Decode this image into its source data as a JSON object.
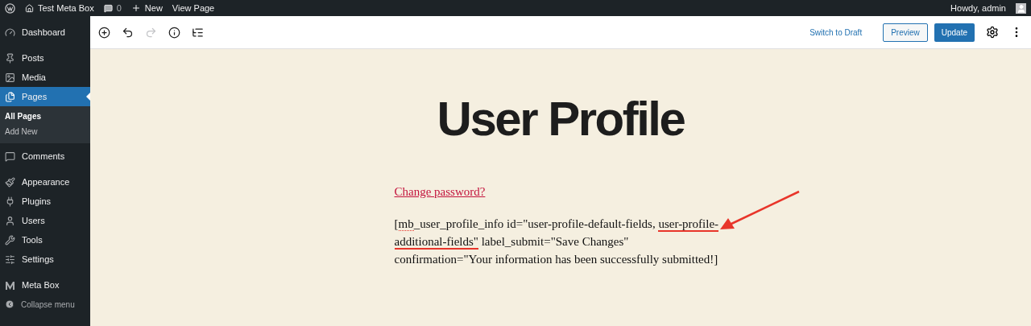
{
  "admin_bar": {
    "site": "Test Meta Box",
    "comments": "0",
    "new": "New",
    "view": "View Page",
    "howdy": "Howdy, admin"
  },
  "sidebar": {
    "items": [
      {
        "label": "Dashboard",
        "selected": false
      },
      {
        "label": "Posts",
        "selected": false
      },
      {
        "label": "Media",
        "selected": false
      },
      {
        "label": "Pages",
        "selected": true,
        "children": [
          {
            "label": "All Pages",
            "selected": true
          },
          {
            "label": "Add New",
            "selected": false
          }
        ]
      },
      {
        "label": "Comments",
        "selected": false
      },
      {
        "label": "Appearance",
        "selected": false
      },
      {
        "label": "Plugins",
        "selected": false
      },
      {
        "label": "Users",
        "selected": false
      },
      {
        "label": "Tools",
        "selected": false
      },
      {
        "label": "Settings",
        "selected": false
      },
      {
        "label": "Meta Box",
        "selected": false
      }
    ],
    "collapse": "Collapse menu"
  },
  "toolbar": {
    "tools": [
      {
        "disabled": false
      },
      {
        "disabled": false
      },
      {
        "disabled": true
      },
      {
        "disabled": false
      },
      {
        "disabled": false
      }
    ],
    "switch_to_draft": "Switch to Draft",
    "preview": "Preview",
    "update": "Update"
  },
  "content": {
    "title": "User Profile",
    "link": "Change password?",
    "lines": [
      [
        {
          "text": "[",
          "underlined": false,
          "spell_error": false
        },
        {
          "text": "mb",
          "underlined": false,
          "spell_error": true
        },
        {
          "text": "_user_profile_info id=\"user-profile-default-fields, ",
          "underlined": false,
          "spell_error": false
        },
        {
          "text": "user-profile-",
          "underlined": true,
          "spell_error": false
        }
      ],
      [
        {
          "text": "additional-fields\"",
          "underlined": true,
          "spell_error": false
        },
        {
          "text": " label_submit=\"Save Changes\"",
          "underlined": false,
          "spell_error": false
        }
      ],
      [
        {
          "text": "confirmation=\"Your information has been successfully submitted!]",
          "underlined": false,
          "spell_error": false
        }
      ]
    ],
    "arrow": true
  }
}
